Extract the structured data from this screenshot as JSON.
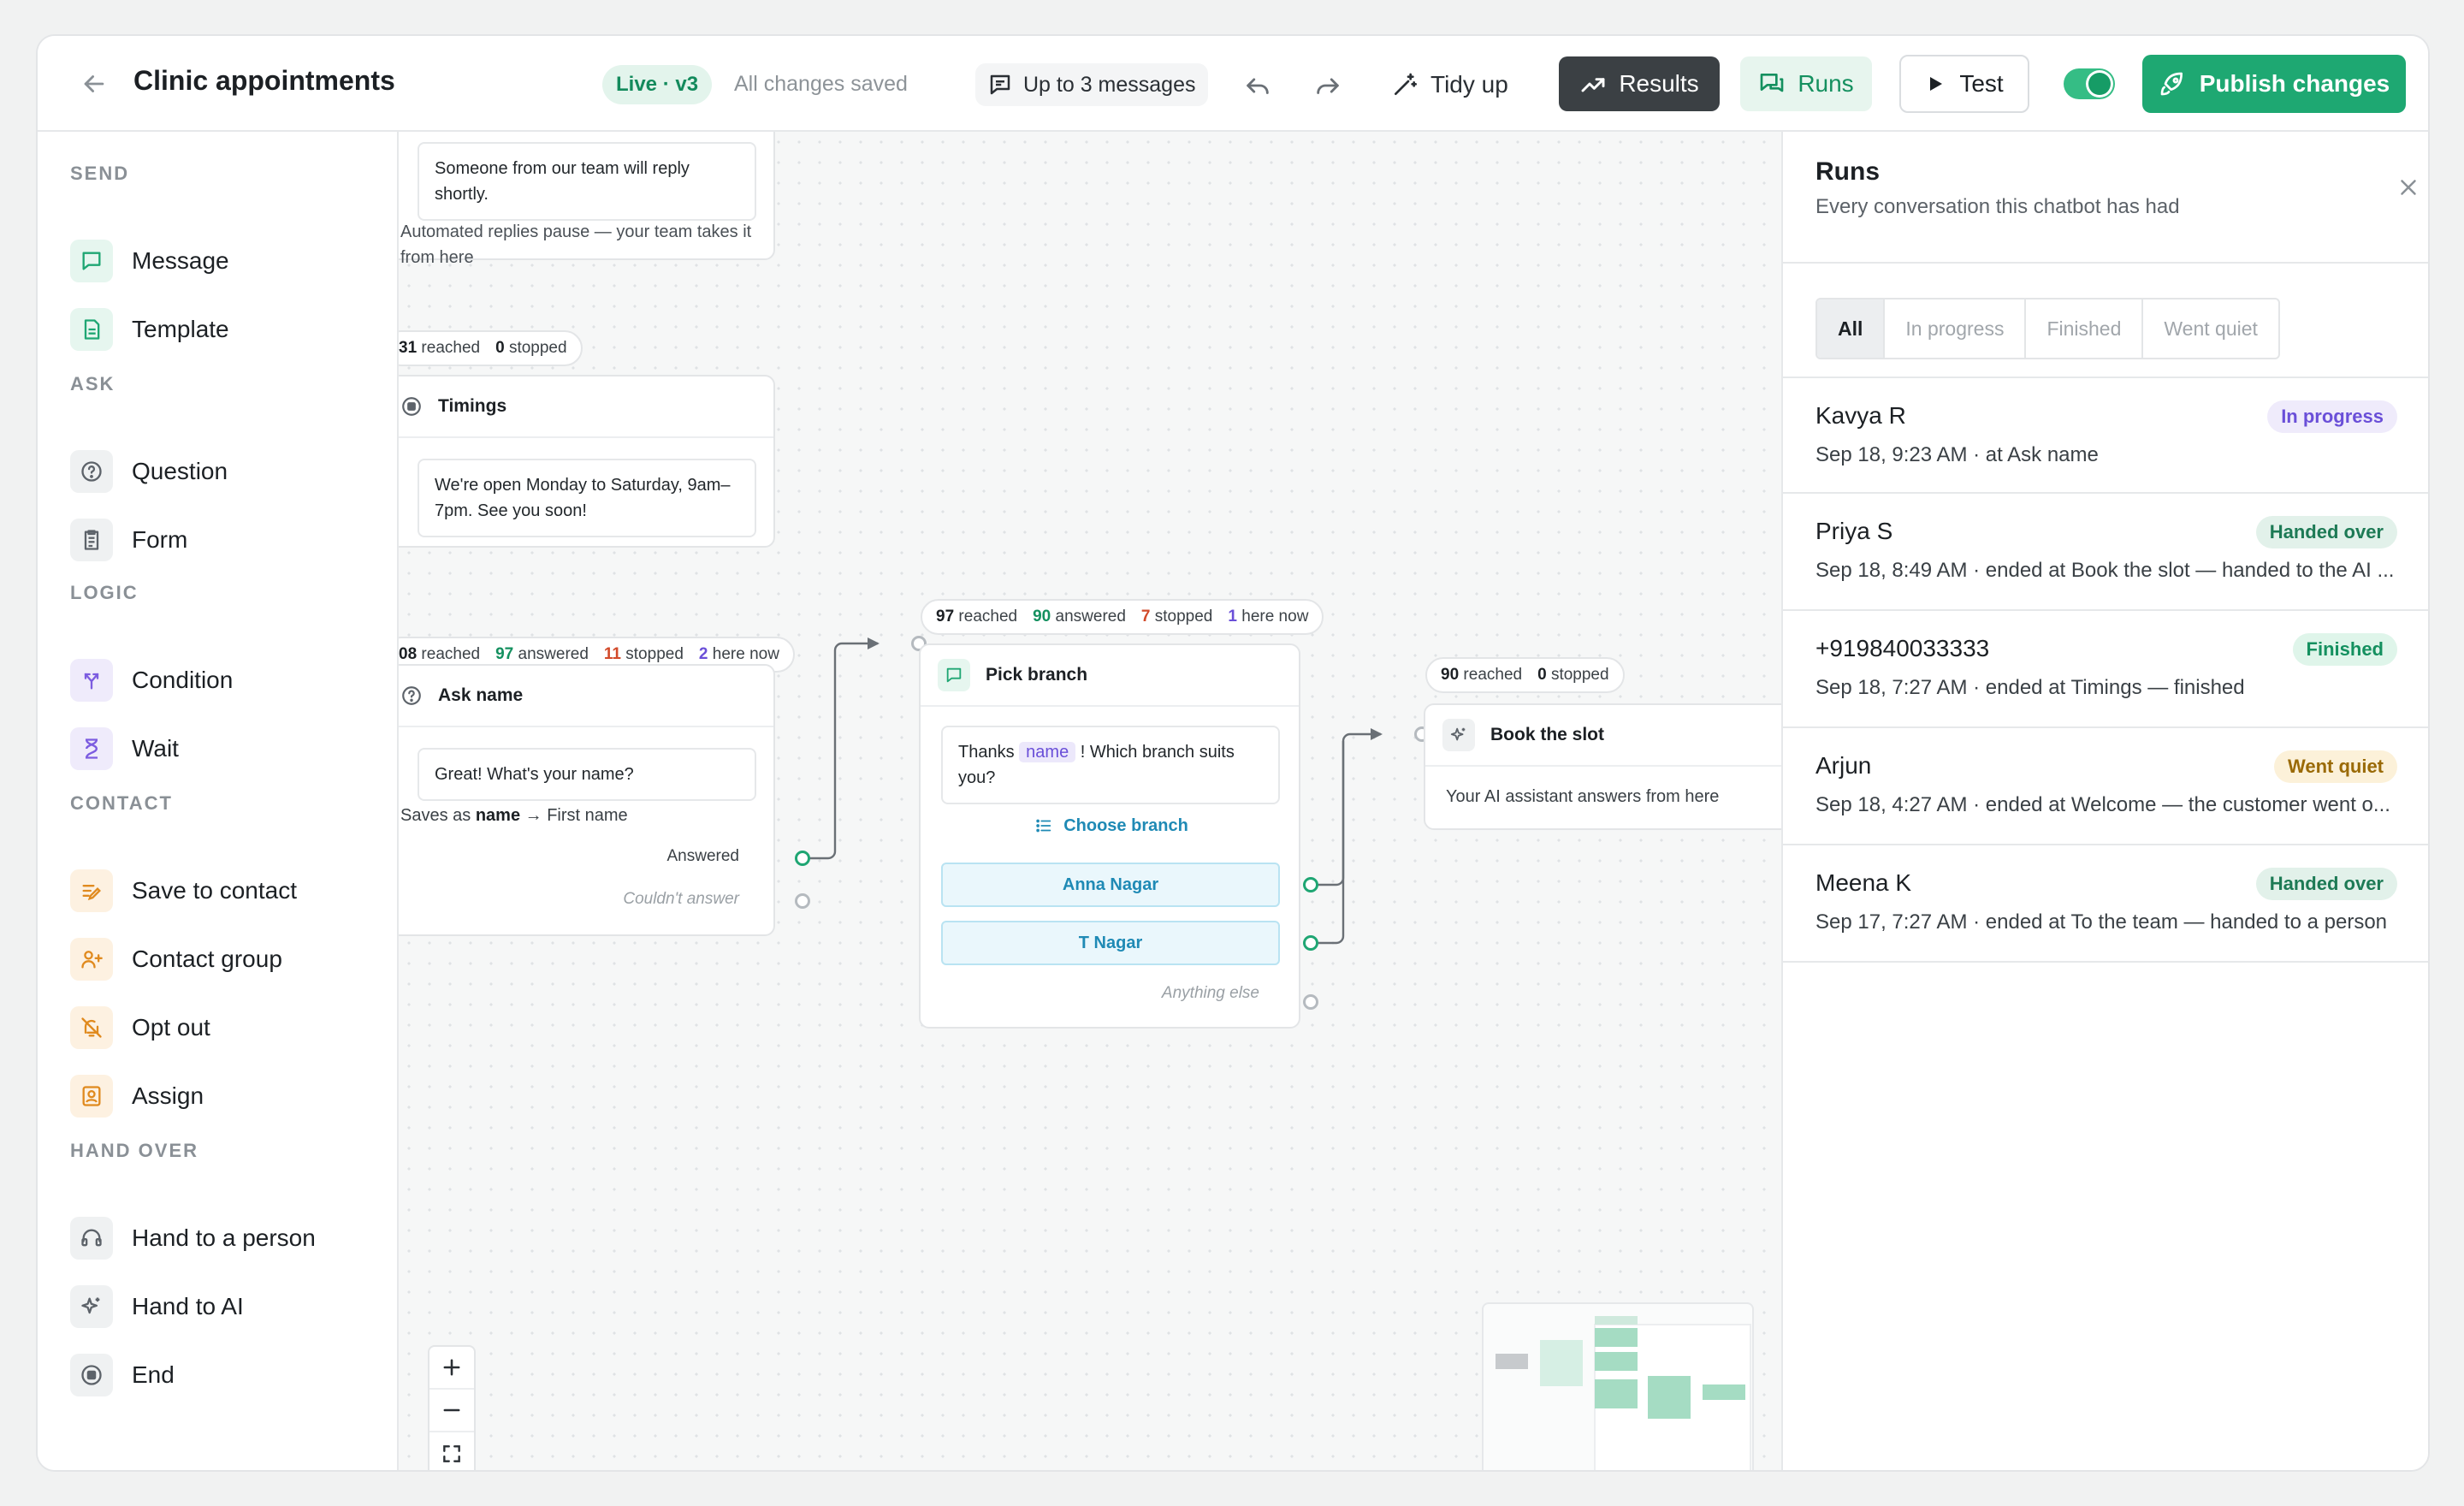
{
  "header": {
    "title": "Clinic appointments",
    "status_pill": "Live · v3",
    "save_status": "All changes saved",
    "message_limit": "Up to 3 messages",
    "tidy_label": "Tidy up",
    "results_label": "Results",
    "runs_label": "Runs",
    "test_label": "Test",
    "publish_label": "Publish changes",
    "colors": {
      "accent": "#1ea872",
      "dark": "#3b4044"
    }
  },
  "sidebar": {
    "sections": [
      {
        "title": "SEND",
        "items": [
          {
            "label": "Message",
            "icon": "message-icon"
          },
          {
            "label": "Template",
            "icon": "template-icon"
          }
        ]
      },
      {
        "title": "ASK",
        "items": [
          {
            "label": "Question",
            "icon": "question-icon"
          },
          {
            "label": "Form",
            "icon": "form-icon"
          }
        ]
      },
      {
        "title": "LOGIC",
        "items": [
          {
            "label": "Condition",
            "icon": "condition-icon"
          },
          {
            "label": "Wait",
            "icon": "hourglass-icon"
          }
        ]
      },
      {
        "title": "CONTACT",
        "items": [
          {
            "label": "Save to contact",
            "icon": "save-contact-icon"
          },
          {
            "label": "Contact group",
            "icon": "contact-group-icon"
          },
          {
            "label": "Opt out",
            "icon": "bell-off-icon"
          },
          {
            "label": "Assign",
            "icon": "assign-icon"
          }
        ]
      },
      {
        "title": "HAND OVER",
        "items": [
          {
            "label": "Hand to a person",
            "icon": "headset-icon"
          },
          {
            "label": "Hand to AI",
            "icon": "sparkle-icon"
          },
          {
            "label": "End",
            "icon": "stop-icon"
          }
        ]
      }
    ]
  },
  "canvas": {
    "handover_node": {
      "message": "Someone from our team will reply shortly.",
      "note": "Automated replies pause — your team takes it from here"
    },
    "timings_stats": {
      "reached": "31",
      "reached_label": "reached",
      "stopped": "0",
      "stopped_label": "stopped"
    },
    "timings_node": {
      "title": "Timings",
      "message": "We're open Monday to Saturday, 9am–7pm. See you soon!"
    },
    "ask_stats": {
      "reached": "08",
      "reached_label": "reached",
      "answered": "97",
      "answered_label": "answered",
      "stopped": "11",
      "stopped_label": "stopped",
      "here": "2",
      "here_label": "here now"
    },
    "ask_node": {
      "title": "Ask name",
      "message": "Great! What's your name?",
      "saves_prefix": "Saves as",
      "saves_var": "name",
      "saves_suffix": "→ First name",
      "answered_label": "Answered",
      "failed_label": "Couldn't answer"
    },
    "branch_stats": {
      "reached": "97",
      "reached_label": "reached",
      "answered": "90",
      "answered_label": "answered",
      "stopped": "7",
      "stopped_label": "stopped",
      "here": "1",
      "here_label": "here now"
    },
    "branch_node": {
      "title": "Pick branch",
      "msg_before": "Thanks",
      "msg_var": "name",
      "msg_after": "! Which branch suits you?",
      "list_label": "Choose branch",
      "options": [
        "Anna Nagar",
        "T Nagar"
      ],
      "fallback": "Anything else"
    },
    "slot_stats": {
      "reached": "90",
      "reached_label": "reached",
      "stopped": "0",
      "stopped_label": "stopped"
    },
    "slot_node": {
      "title": "Book the slot",
      "note": "Your AI assistant answers from here"
    }
  },
  "runs_panel": {
    "title": "Runs",
    "subtitle": "Every conversation this chatbot has had",
    "filters": [
      "All",
      "In progress",
      "Finished",
      "Went quiet"
    ],
    "active_filter": "All",
    "runs": [
      {
        "name": "Kavya R",
        "meta": "Sep 18, 9:23 AM · at Ask name",
        "status": "In progress",
        "color": "#6a4fd8",
        "bg": "#efebfb"
      },
      {
        "name": "Priya S",
        "meta": "Sep 18, 8:49 AM · ended at Book the slot — handed to the AI ...",
        "status": "Handed over",
        "color": "#1d7a55",
        "bg": "#e2f1ea"
      },
      {
        "name": "+919840033333",
        "meta": "Sep 18, 7:27 AM · ended at Timings — finished",
        "status": "Finished",
        "color": "#14905f",
        "bg": "#dff5ea"
      },
      {
        "name": "Arjun",
        "meta": "Sep 18, 4:27 AM · ended at Welcome — the customer went o...",
        "status": "Went quiet",
        "color": "#9a6a06",
        "bg": "#fcf1d9"
      },
      {
        "name": "Meena K",
        "meta": "Sep 17, 7:27 AM · ended at To the team — handed to a person",
        "status": "Handed over",
        "color": "#1d7a55",
        "bg": "#e2f1ea"
      }
    ]
  }
}
